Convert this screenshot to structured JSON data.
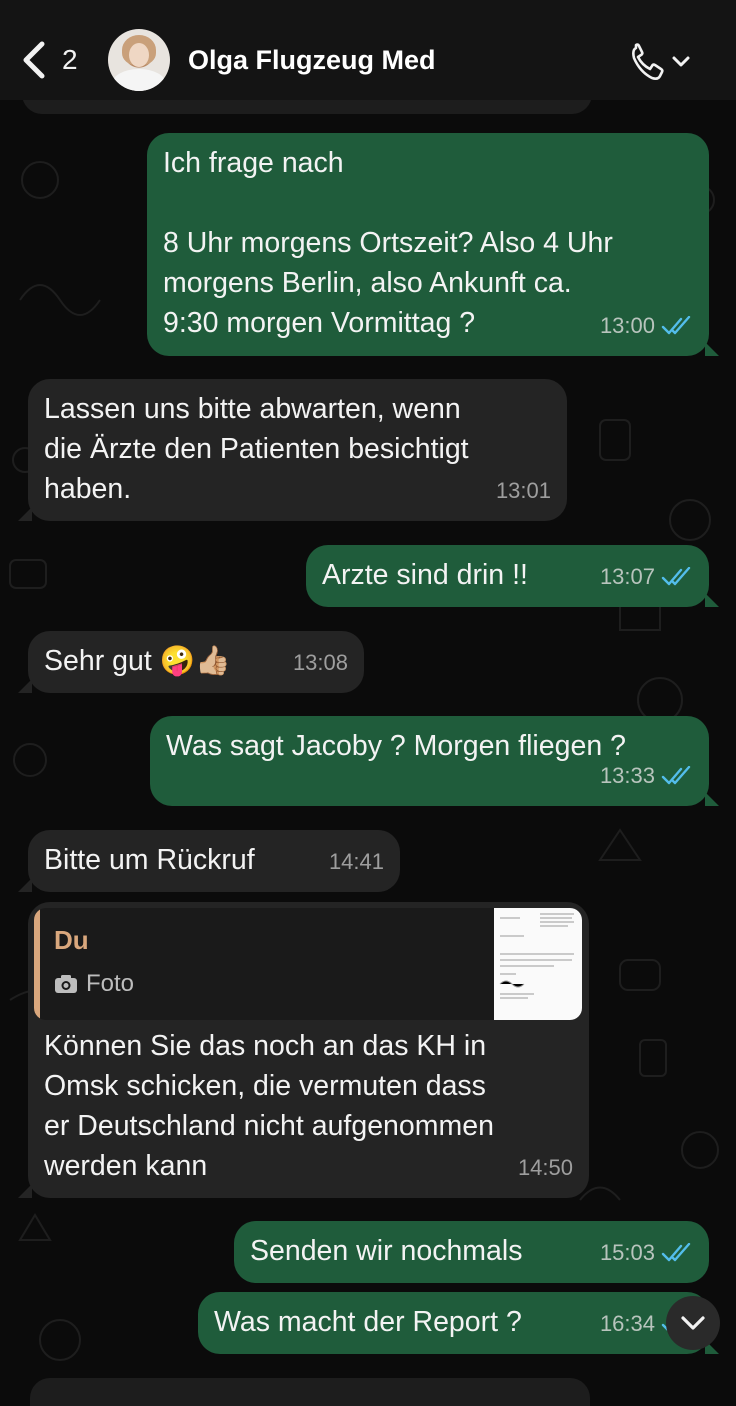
{
  "header": {
    "back_icon": "chevron-left-icon",
    "unread_count": "2",
    "contact_name": "Olga Flugzeug Med",
    "call_icon": "phone-icon"
  },
  "colors": {
    "outgoing_bubble": "#1f5c3b",
    "incoming_bubble": "#242424",
    "read_ticks": "#53bdeb",
    "quote_author": "#d9a77d"
  },
  "messages": [
    {
      "dir": "out",
      "text": "Ich frage nach\n\n8 Uhr morgens Ortszeit? Also 4 Uhr\nmorgens Berlin, also Ankunft ca.\n9:30 morgen Vormittag ?",
      "time": "13:00",
      "status": "read"
    },
    {
      "dir": "in",
      "text": "Lassen uns bitte abwarten, wenn\ndie Ärzte den Patienten besichtigt\nhaben.",
      "time": "13:01"
    },
    {
      "dir": "out",
      "text": "Arzte sind drin !!",
      "time": "13:07",
      "status": "read"
    },
    {
      "dir": "in",
      "text": "Sehr gut 🤪👍🏼",
      "time": "13:08"
    },
    {
      "dir": "out",
      "text": "Was sagt Jacoby ? Morgen fliegen ?",
      "time": "13:33",
      "status": "read"
    },
    {
      "dir": "in",
      "text": "Bitte um Rückruf",
      "time": "14:41"
    },
    {
      "dir": "in",
      "quote": {
        "author": "Du",
        "kind": "Foto"
      },
      "text": "Können Sie das noch an das KH in\nOmsk schicken, die vermuten dass\ner Deutschland nicht aufgenommen\nwerden kann",
      "time": "14:50"
    },
    {
      "dir": "out",
      "text": "Senden wir nochmals",
      "time": "15:03",
      "status": "read"
    },
    {
      "dir": "out",
      "text": "Was macht der Report ?",
      "time": "16:34",
      "status": "read"
    }
  ],
  "scroll_button_icon": "chevron-down-icon"
}
